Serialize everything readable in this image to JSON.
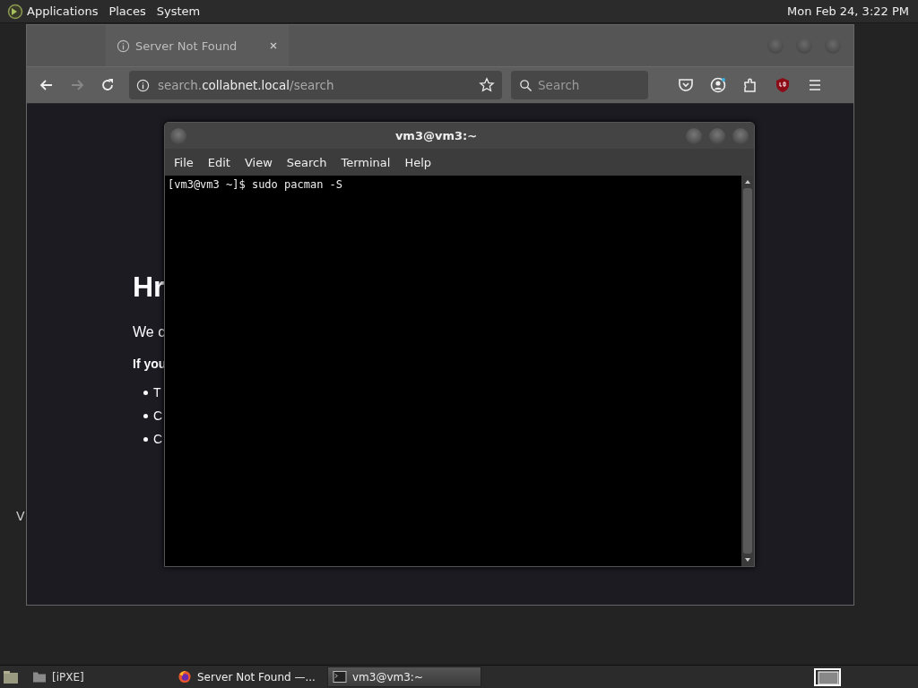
{
  "top_panel": {
    "menus": [
      "Applications",
      "Places",
      "System"
    ],
    "clock": "Mon Feb 24,  3:22 PM"
  },
  "desktop": {
    "stray_text": "V"
  },
  "browser": {
    "tabs": [
      {
        "title": "Server Not Found",
        "selected": true
      }
    ],
    "url": {
      "prefix": "search.",
      "domain": "collabnet.local",
      "path": "/search"
    },
    "search": {
      "placeholder": "Search"
    },
    "page": {
      "heading": "Hr",
      "paragraph": "We c",
      "bold_line": "If you",
      "bullets": [
        "T",
        "C",
        "C"
      ]
    }
  },
  "terminal": {
    "title": "vm3@vm3:~",
    "menus": [
      "File",
      "Edit",
      "View",
      "Search",
      "Terminal",
      "Help"
    ],
    "lines": [
      "[vm3@vm3 ~]$ sudo pacman -S"
    ]
  },
  "taskbar": {
    "items": [
      {
        "kind": "folder",
        "label": "[iPXE]",
        "selected": false
      },
      {
        "kind": "firefox",
        "label": "Server Not Found —...",
        "selected": false
      },
      {
        "kind": "terminal",
        "label": "vm3@vm3:~",
        "selected": true
      }
    ]
  }
}
